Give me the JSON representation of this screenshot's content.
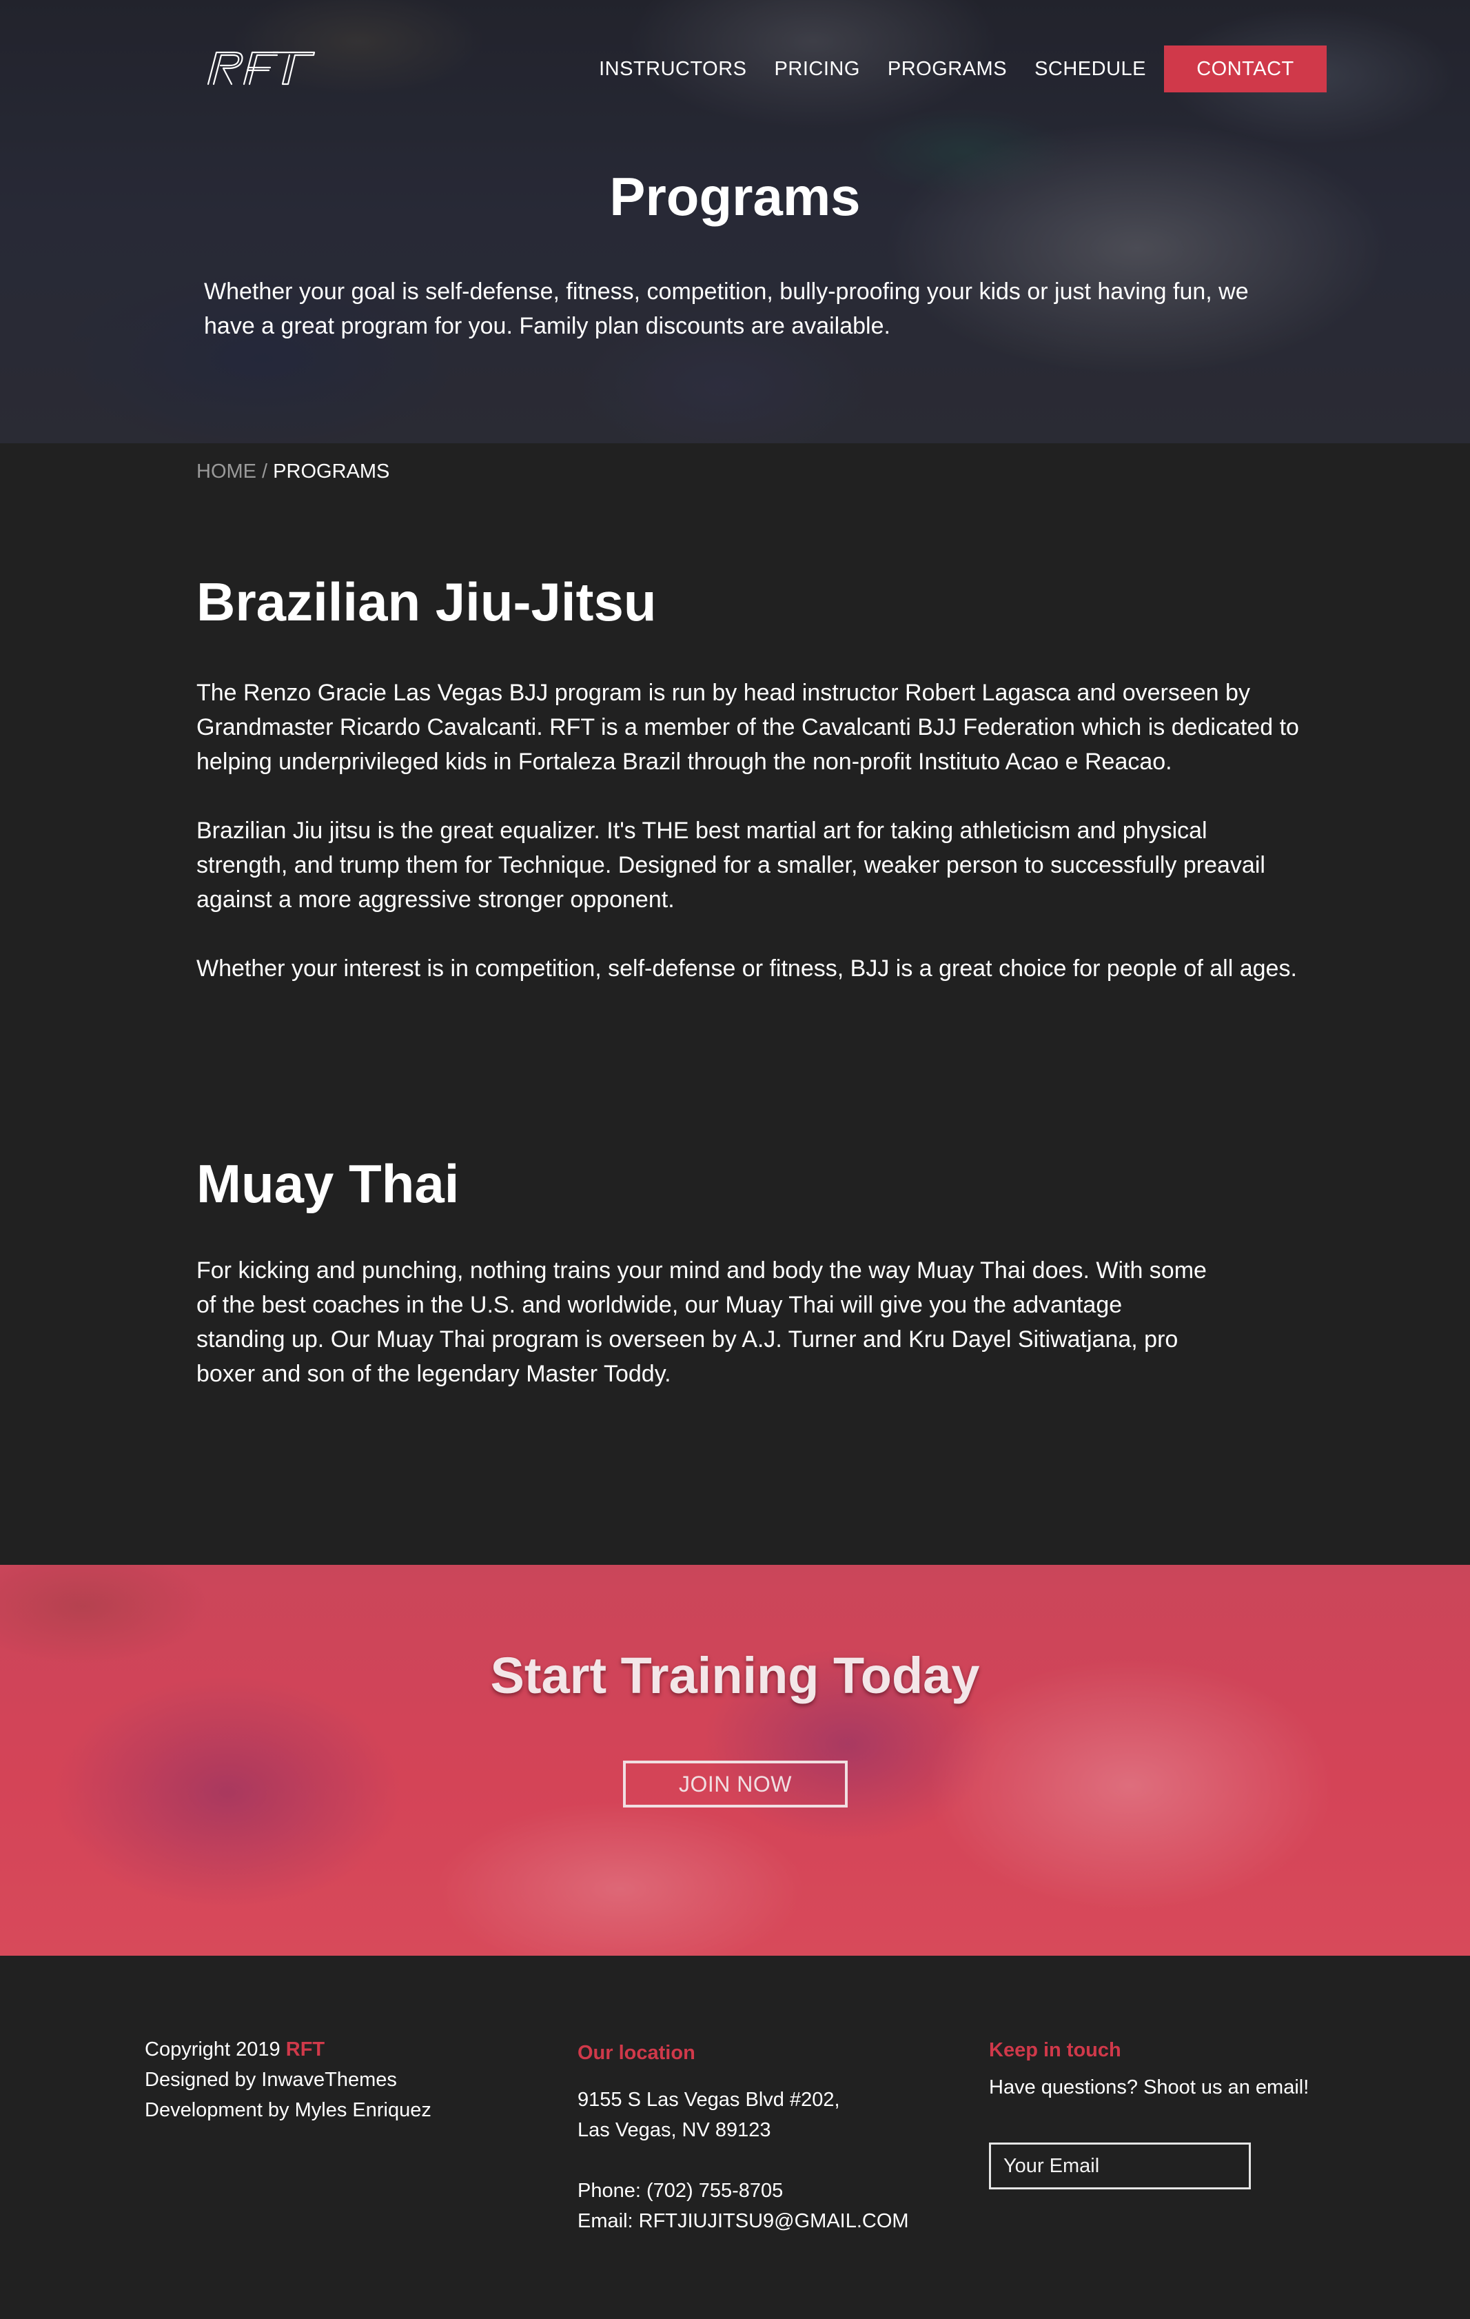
{
  "header": {
    "logo_text": "RFT",
    "nav": [
      {
        "label": "INSTRUCTORS"
      },
      {
        "label": "PRICING"
      },
      {
        "label": "PROGRAMS"
      },
      {
        "label": "SCHEDULE"
      }
    ],
    "contact_label": "CONTACT"
  },
  "hero": {
    "title": "Programs",
    "intro": "Whether your goal is self-defense, fitness, competition, bully-proofing your kids or just having fun, we have a great program for you. Family plan discounts are available."
  },
  "breadcrumb": {
    "home": "HOME",
    "separator": " / ",
    "current": "PROGRAMS"
  },
  "programs": [
    {
      "title": "Brazilian Jiu-Jitsu",
      "paragraphs": [
        "The Renzo Gracie Las Vegas BJJ program is run by head instructor Robert Lagasca and overseen by Grandmaster Ricardo Cavalcanti. RFT is a member of the Cavalcanti BJJ Federation which is dedicated to helping underprivileged kids in Fortaleza Brazil through the non-profit Instituto Acao e Reacao.",
        "Brazilian Jiu jitsu is the great equalizer. It's THE best martial art for taking athleticism and physical strength, and trump them for Technique. Designed for a smaller, weaker person to successfully preavail against a more aggressive stronger opponent.",
        "Whether your interest is in competition, self-defense or fitness, BJJ is a great choice for people of all ages."
      ]
    },
    {
      "title": "Muay Thai",
      "paragraphs": [
        "For kicking and punching, nothing trains your mind and body the way Muay Thai does. With some of the best coaches in the U.S. and worldwide, our Muay Thai will give you the advantage standing up. Our Muay Thai program is overseen by A.J. Turner and Kru Dayel Sitiwatjana, pro boxer and son of the legendary Master Toddy."
      ]
    }
  ],
  "cta": {
    "title": "Start Training Today",
    "button": "JOIN NOW"
  },
  "footer": {
    "copyright_prefix": "Copyright 2019",
    "copyright_brand": "RFT",
    "designed_by": "Designed by InwaveThemes",
    "development_by": "Development by Myles Enriquez",
    "location_heading": "Our location",
    "address_line1": "9155 S Las Vegas Blvd #202,",
    "address_line2": "Las Vegas, NV 89123",
    "phone": "Phone: (702) 755-8705",
    "email": "Email: RFTJIUJITSU9@GMAIL.COM",
    "contact_heading": "Keep in touch",
    "contact_text": "Have questions? Shoot us an email!",
    "email_placeholder": "Your Email"
  },
  "colors": {
    "accent": "#d0394a",
    "background": "#212121"
  }
}
